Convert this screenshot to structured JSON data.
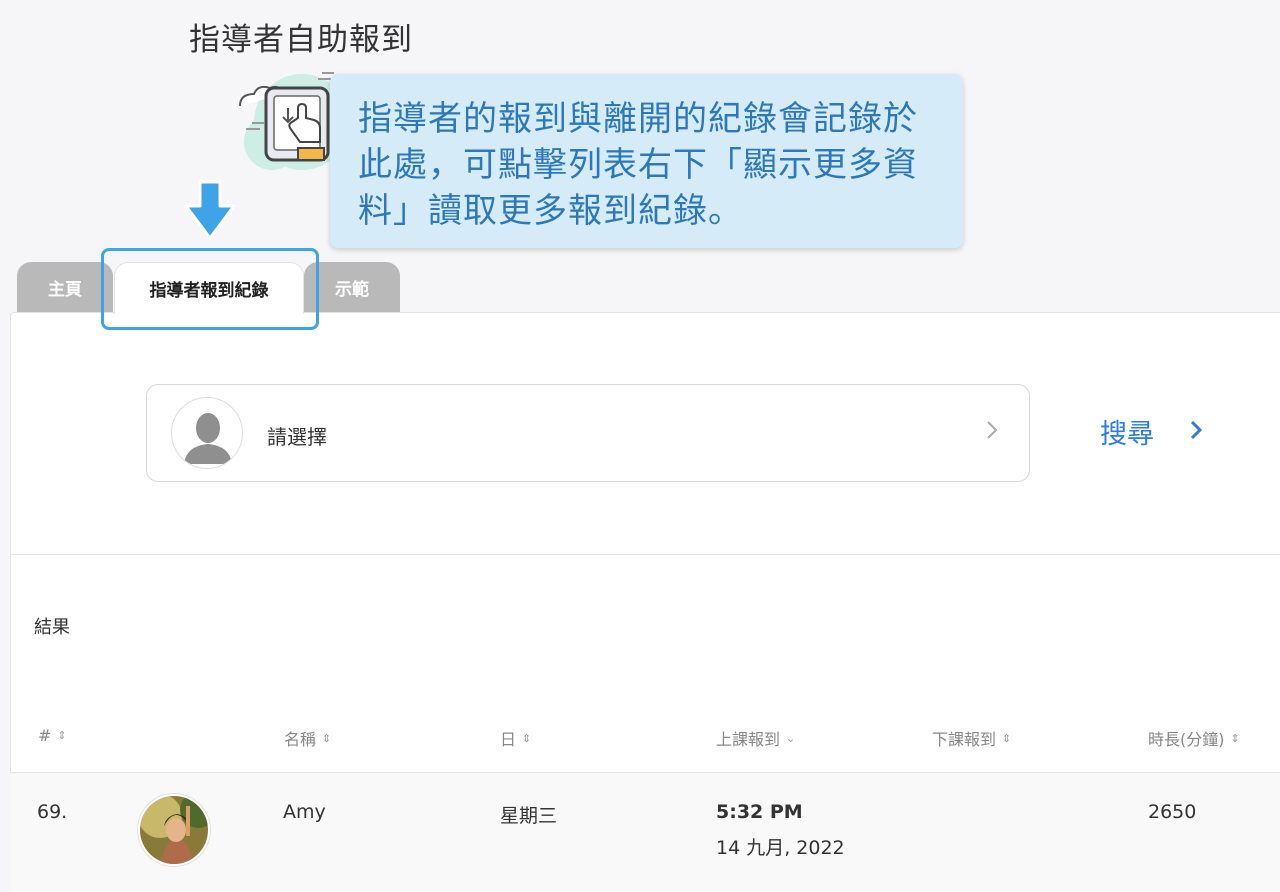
{
  "page": {
    "title": "指導者自助報到"
  },
  "tooltip": {
    "text": "指導者的報到與離開的紀錄會記錄於此處，可點擊列表右下「顯示更多資料」讀取更多報到紀錄。"
  },
  "tabs": [
    {
      "label": "主頁"
    },
    {
      "label": "指導者報到紀錄"
    },
    {
      "label": "示範"
    }
  ],
  "selector": {
    "label": "請選擇"
  },
  "search": {
    "label": "搜尋"
  },
  "results": {
    "label": "結果"
  },
  "table": {
    "headers": [
      {
        "label": "#",
        "sort": "both"
      },
      {
        "label": "名稱",
        "sort": "both"
      },
      {
        "label": "日",
        "sort": "both"
      },
      {
        "label": "上課報到",
        "sort": "desc"
      },
      {
        "label": "下課報到",
        "sort": "both"
      },
      {
        "label": "時長(分鐘)",
        "sort": "both"
      }
    ],
    "rows": [
      {
        "index": "69.",
        "name": "Amy",
        "day": "星期三",
        "checkin_time": "5:32 PM",
        "checkin_date": "14 九月, 2022",
        "checkout": "",
        "duration": "2650"
      }
    ]
  },
  "colors": {
    "accent": "#2b7be0",
    "tooltip_bg": "#d6ebf8",
    "tooltip_text": "#2c78b8",
    "highlight": "#3fa3e8",
    "tab_inactive": "#b9b9b9"
  }
}
